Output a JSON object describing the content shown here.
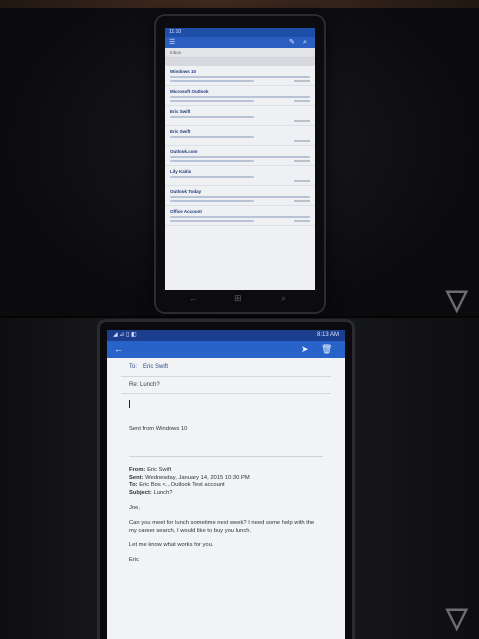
{
  "top_phone": {
    "status_time": "11:10",
    "list_title": "Inbox",
    "senders": [
      "Windows 10",
      "Microsoft Outlook",
      "Eric Swift",
      "Eric Swift",
      "Outlook.com",
      "Lily Kaitis",
      "Outlook Today",
      "Office Account"
    ]
  },
  "bottom_phone": {
    "status_signal": "◢ ⊿ ▯ ◧",
    "status_time": "8:13 AM",
    "to_label": "To:",
    "to_value": "Eric Swift",
    "subject_value": "Re: Lunch?",
    "sent_from": "Sent from Windows 10",
    "from_label": "From:",
    "from_value": "Eric Swift",
    "sent_label": "Sent:",
    "sent_value": "Wednesday, January 14, 2015 10:30 PM",
    "to_label_2": "To:",
    "to_value_2": "Eric Bos <...Outlook Test account",
    "subject_label": "Subject:",
    "subject_value_2": "Lunch?",
    "greeting": "Joe,",
    "body_1": "Can you meet for lunch sometime next week? I need some help with the my career search, I would like to buy you lunch.",
    "body_2": "Let me know what works for you.",
    "signoff": "Eric"
  },
  "watermark_glyph": "▽"
}
